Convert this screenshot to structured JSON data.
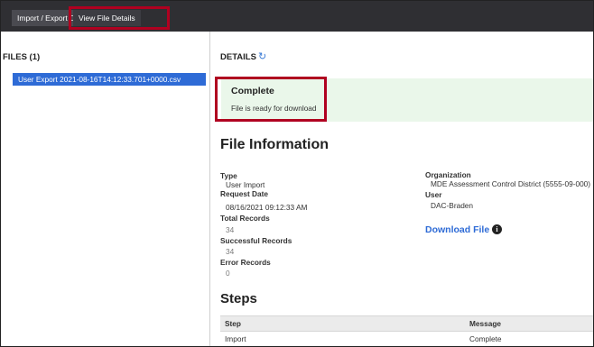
{
  "tabs": [
    {
      "label": "Import / Export Data",
      "active": false
    },
    {
      "label": "View File Details",
      "active": true
    }
  ],
  "files": {
    "title": "FILES (1)",
    "items": [
      "User Export 2021-08-16T14:12:33.701+0000.csv"
    ]
  },
  "details": {
    "title": "DETAILS",
    "refresh_icon": "refresh-icon",
    "status": {
      "title": "Complete",
      "message": "File is ready for download",
      "color": "#eaf7ea"
    },
    "file_info_heading": "File Information",
    "left_fields": [
      {
        "label": "Type",
        "value": "User Import"
      },
      {
        "label": "Request Date",
        "value": "08/16/2021 09:12:33 AM"
      },
      {
        "label": "Total Records",
        "value": "34"
      },
      {
        "label": "Successful Records",
        "value": "34"
      },
      {
        "label": "Error Records",
        "value": "0"
      }
    ],
    "right_fields": [
      {
        "label": "Organization",
        "value": "MDE Assessment Control District (5555-09-000)"
      },
      {
        "label": "User",
        "value": "DAC-Braden"
      }
    ],
    "download_label": "Download File",
    "info_icon": "info-circle-icon",
    "steps_heading": "Steps",
    "steps": {
      "columns": [
        "Step",
        "Message"
      ],
      "rows": [
        [
          "Import",
          "Complete"
        ]
      ]
    }
  },
  "colors": {
    "tab_bar": "#2f2f33",
    "selected_file": "#2e6bd6",
    "highlight_outline": "#b00020",
    "link": "#2e6bd6"
  }
}
